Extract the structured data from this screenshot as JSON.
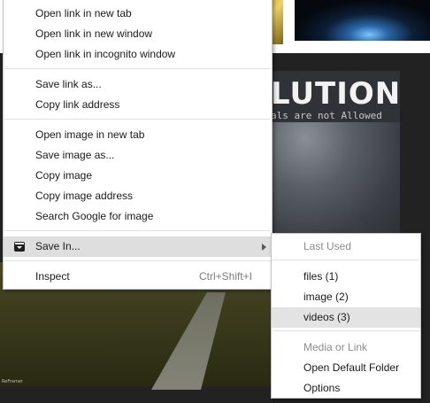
{
  "background": {
    "poster_title": "LUTION",
    "poster_subtitle": "als are not Allowed",
    "photo_caption": "ReFramer"
  },
  "context_menu": {
    "items": [
      {
        "label": "Open link in new tab"
      },
      {
        "label": "Open link in new window"
      },
      {
        "label": "Open link in incognito window"
      },
      {
        "label": "Save link as..."
      },
      {
        "label": "Copy link address"
      },
      {
        "label": "Open image in new tab"
      },
      {
        "label": "Save image as..."
      },
      {
        "label": "Copy image"
      },
      {
        "label": "Copy image address"
      },
      {
        "label": "Search Google for image"
      },
      {
        "label": "Save In...",
        "icon": "save-in-icon",
        "has_submenu": true,
        "highlighted": true
      },
      {
        "label": "Inspect",
        "shortcut": "Ctrl+Shift+I"
      }
    ]
  },
  "submenu": {
    "items": [
      {
        "label": "Last Used",
        "header": true
      },
      {
        "label": "files (1)"
      },
      {
        "label": "image (2)"
      },
      {
        "label": "videos (3)",
        "highlighted": true
      },
      {
        "label": "Media or Link",
        "header": true
      },
      {
        "label": "Open Default Folder"
      },
      {
        "label": "Options"
      }
    ]
  }
}
